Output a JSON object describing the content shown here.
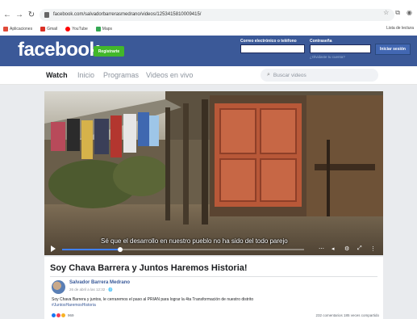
{
  "browser": {
    "url": "facebook.com/salvadorbarrerasmedrano/videos/1253415810009415/",
    "bookmarks": [
      {
        "label": "Aplicaciones",
        "color": "#e04b3a"
      },
      {
        "label": "Gmail",
        "color": "#d93025"
      },
      {
        "label": "YouTube",
        "color": "#ff0000"
      },
      {
        "label": "Maps",
        "color": "#34a853"
      }
    ],
    "reading_list": "Lista de lectura"
  },
  "header": {
    "logo": "facebook",
    "register_label": "Registrarte",
    "email_label": "Correo electrónico o teléfono",
    "password_label": "Contraseña",
    "forgot_label": "¿Olvidaste tu cuenta?",
    "login_label": "Iniciar sesión",
    "brand_color": "#3b5998"
  },
  "watch_nav": {
    "tabs": [
      {
        "label": "Watch"
      },
      {
        "label": "Inicio"
      },
      {
        "label": "Programas"
      },
      {
        "label": "Videos en vivo"
      }
    ],
    "search_placeholder": "Buscar videos"
  },
  "video": {
    "subtitle": "Sé que el desarrollo en nuestro pueblo no ha sido del todo parejo",
    "progress_fraction": 0.24
  },
  "post": {
    "title": "Soy Chava Barrera y Juntos Haremos Historia!",
    "author": "Salvador Barrera Medrano",
    "date": "26 de abril a las 12:32 · 🌐",
    "body_line1": "Soy Chava Barrera y juntos, le cerraremos el paso al PRIAN para lograr la 4ta Transformación de nuestro distrito",
    "body_line2": "#JuntosHaremosHistoria",
    "reactions_count": "969",
    "stats": "232 comentarios  185 veces compartido"
  }
}
